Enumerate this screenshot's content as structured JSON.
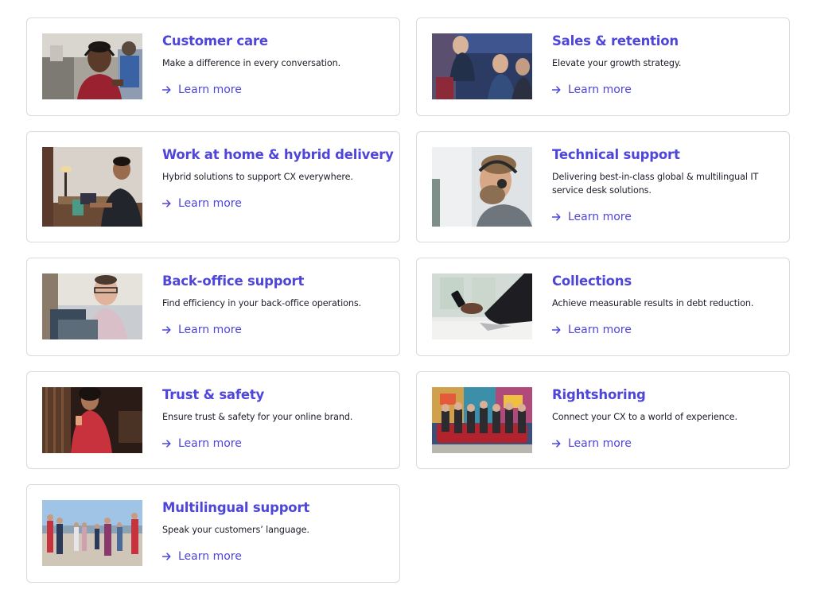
{
  "link_label": "Learn more",
  "accent_color": "#4f46d9",
  "cards": [
    {
      "title": "Customer care",
      "description": "Make a difference in every conversation.",
      "image": "agent-with-headset-photo"
    },
    {
      "title": "Sales & retention",
      "description": "Elevate your growth strategy.",
      "image": "call-center-team-photo"
    },
    {
      "title": "Work at home & hybrid delivery",
      "description": "Hybrid solutions to support CX everywhere.",
      "image": "man-working-at-desk-photo"
    },
    {
      "title": "Technical support",
      "description": "Delivering best-in-class global & multilingual IT service desk solutions.",
      "image": "bearded-agent-headset-photo"
    },
    {
      "title": "Back-office support",
      "description": "Find efficiency in your back-office operations.",
      "image": "smiling-man-glasses-photo"
    },
    {
      "title": "Collections",
      "description": "Achieve measurable results in debt reduction.",
      "image": "hand-holding-phone-photo"
    },
    {
      "title": "Trust & safety",
      "description": "Ensure trust & safety for your online brand.",
      "image": "woman-with-phone-photo"
    },
    {
      "title": "Rightshoring",
      "description": "Connect your CX to a world of experience.",
      "image": "group-on-red-sofa-photo"
    },
    {
      "title": "Multilingual support",
      "description": "Speak your customers’ language.",
      "image": "group-walking-outdoors-photo"
    }
  ]
}
